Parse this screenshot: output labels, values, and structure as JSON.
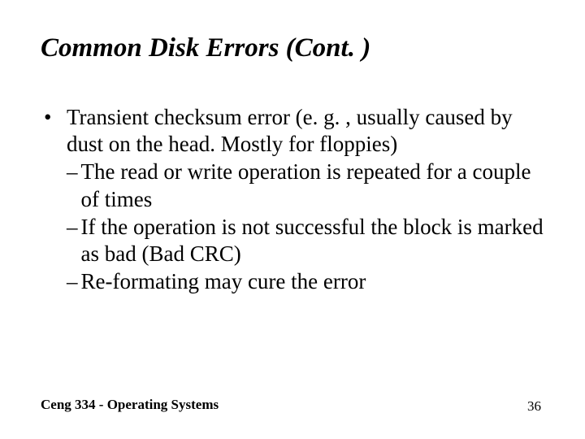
{
  "title": "Common Disk Errors (Cont. )",
  "bullet": {
    "mark": "•",
    "text": "Transient checksum error (e. g. , usually caused by dust on the head. Mostly for floppies)"
  },
  "subs": [
    {
      "mark": "–",
      "text": "The read or write operation is repeated for a couple of times"
    },
    {
      "mark": "–",
      "text": "If the operation is not successful the block is marked as bad (Bad CRC)"
    },
    {
      "mark": "–",
      "text": "Re-formating may cure the error"
    }
  ],
  "footer": {
    "left": "Ceng 334 - Operating Systems",
    "right": "36"
  }
}
